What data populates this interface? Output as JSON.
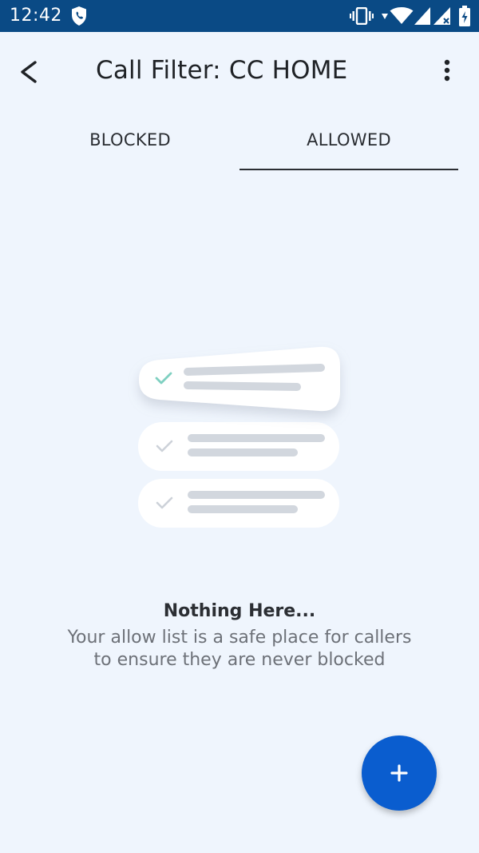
{
  "status_bar": {
    "time": "12:42",
    "icons": [
      "shield-phone-icon",
      "vibrate-icon",
      "data-arrows-icon",
      "wifi-icon",
      "signal-icon",
      "signal-no-data-icon",
      "battery-charging-icon"
    ]
  },
  "app_bar": {
    "title": "Call Filter: CC HOME",
    "back_icon": "back-arrow-icon",
    "menu_icon": "more-vert-icon"
  },
  "tabs": [
    {
      "label": "BLOCKED",
      "selected": false
    },
    {
      "label": "ALLOWED",
      "selected": true
    }
  ],
  "empty_state": {
    "illustration": "checklist-illustration",
    "title": "Nothing Here...",
    "description_line1": "Your allow list is a safe place for callers",
    "description_line2": "to ensure they are never blocked"
  },
  "fab": {
    "icon": "plus-icon"
  },
  "colors": {
    "status_bar": "#0a4a85",
    "background": "#eff5fd",
    "fab": "#0a5dcf",
    "check_accent": "#7fd0c1"
  }
}
